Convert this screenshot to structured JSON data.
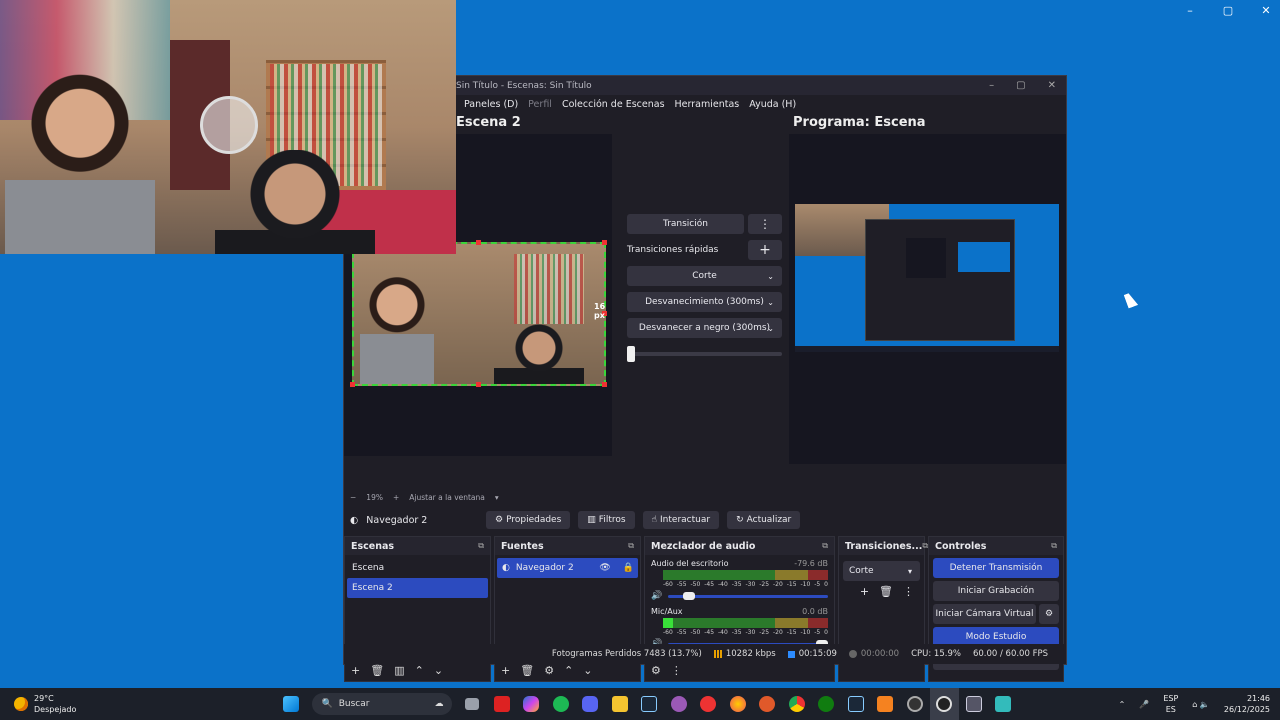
{
  "desktop": {
    "window_controls": [
      "–",
      "▢",
      "✕"
    ]
  },
  "obs": {
    "title": "Sin Título - Escenas: Sin Título",
    "menu": [
      "Paneles (D)",
      "Perfil",
      "Colección de Escenas",
      "Herramientas",
      "Ayuda (H)"
    ],
    "preview_title": "Escena 2",
    "program_title": "Programa: Escena",
    "size_label": "16 px",
    "transition_button": "Transición",
    "quick_transitions_label": "Transiciones rápidas",
    "quick_transitions": [
      "Corte",
      "Desvanecimiento (300ms)",
      "Desvanecer a negro (300ms)"
    ],
    "zoom": {
      "minus": "−",
      "value": "19%",
      "plus": "+",
      "fit": "Ajustar a la ventana",
      "dropdown": "▾"
    },
    "source_bar": {
      "selected_source": "Navegador 2",
      "properties": "Propiedades",
      "filters": "Filtros",
      "interact": "Interactuar",
      "refresh": "Actualizar"
    },
    "docks": {
      "scenes": {
        "title": "Escenas",
        "items": [
          "Escena",
          "Escena 2"
        ],
        "selected_index": 1
      },
      "sources": {
        "title": "Fuentes",
        "items": [
          "Navegador 2"
        ]
      },
      "mixer": {
        "title": "Mezclador de audio",
        "ticks": [
          "-60",
          "-55",
          "-50",
          "-45",
          "-40",
          "-35",
          "-30",
          "-25",
          "-20",
          "-15",
          "-10",
          "-5",
          "0"
        ],
        "channels": [
          {
            "name": "Audio del escritorio",
            "db": "-79.6 dB",
            "volume": 0.1
          },
          {
            "name": "Mic/Aux",
            "db": "0.0 dB",
            "volume": 1.0
          }
        ]
      },
      "transitions": {
        "title": "Transiciones...",
        "selected": "Corte"
      },
      "controls": {
        "title": "Controles",
        "stop_stream": "Detener Transmisión",
        "start_recording": "Iniciar Grabación",
        "start_virtual_cam": "Iniciar Cámara Virtual",
        "studio_mode": "Modo Estudio",
        "settings": "Ajustes"
      }
    },
    "status": {
      "dropped_frames": "Fotogramas Perdidos 7483 (13.7%)",
      "bitrate": "10282 kbps",
      "stream_time": "00:15:09",
      "record_time": "00:00:00",
      "cpu": "CPU: 15.9%",
      "fps": "60.00 / 60.00 FPS"
    }
  },
  "taskbar": {
    "weather_temp": "29°C",
    "weather_desc": "Despejado",
    "search_placeholder": "Buscar",
    "lang_top": "ESP",
    "lang_bottom": "ES",
    "time": "21:46",
    "date": "26/12/2025",
    "colors": {
      "accent": "#2c4bbf",
      "desktop": "#0b72c9"
    }
  }
}
